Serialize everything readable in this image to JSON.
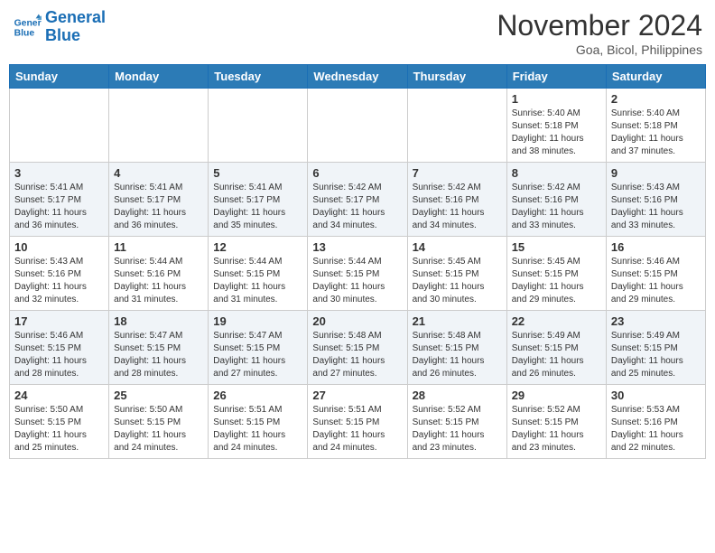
{
  "header": {
    "logo_line1": "General",
    "logo_line2": "Blue",
    "month": "November 2024",
    "location": "Goa, Bicol, Philippines"
  },
  "weekdays": [
    "Sunday",
    "Monday",
    "Tuesday",
    "Wednesday",
    "Thursday",
    "Friday",
    "Saturday"
  ],
  "weeks": [
    [
      {
        "day": "",
        "info": ""
      },
      {
        "day": "",
        "info": ""
      },
      {
        "day": "",
        "info": ""
      },
      {
        "day": "",
        "info": ""
      },
      {
        "day": "",
        "info": ""
      },
      {
        "day": "1",
        "info": "Sunrise: 5:40 AM\nSunset: 5:18 PM\nDaylight: 11 hours\nand 38 minutes."
      },
      {
        "day": "2",
        "info": "Sunrise: 5:40 AM\nSunset: 5:18 PM\nDaylight: 11 hours\nand 37 minutes."
      }
    ],
    [
      {
        "day": "3",
        "info": "Sunrise: 5:41 AM\nSunset: 5:17 PM\nDaylight: 11 hours\nand 36 minutes."
      },
      {
        "day": "4",
        "info": "Sunrise: 5:41 AM\nSunset: 5:17 PM\nDaylight: 11 hours\nand 36 minutes."
      },
      {
        "day": "5",
        "info": "Sunrise: 5:41 AM\nSunset: 5:17 PM\nDaylight: 11 hours\nand 35 minutes."
      },
      {
        "day": "6",
        "info": "Sunrise: 5:42 AM\nSunset: 5:17 PM\nDaylight: 11 hours\nand 34 minutes."
      },
      {
        "day": "7",
        "info": "Sunrise: 5:42 AM\nSunset: 5:16 PM\nDaylight: 11 hours\nand 34 minutes."
      },
      {
        "day": "8",
        "info": "Sunrise: 5:42 AM\nSunset: 5:16 PM\nDaylight: 11 hours\nand 33 minutes."
      },
      {
        "day": "9",
        "info": "Sunrise: 5:43 AM\nSunset: 5:16 PM\nDaylight: 11 hours\nand 33 minutes."
      }
    ],
    [
      {
        "day": "10",
        "info": "Sunrise: 5:43 AM\nSunset: 5:16 PM\nDaylight: 11 hours\nand 32 minutes."
      },
      {
        "day": "11",
        "info": "Sunrise: 5:44 AM\nSunset: 5:16 PM\nDaylight: 11 hours\nand 31 minutes."
      },
      {
        "day": "12",
        "info": "Sunrise: 5:44 AM\nSunset: 5:15 PM\nDaylight: 11 hours\nand 31 minutes."
      },
      {
        "day": "13",
        "info": "Sunrise: 5:44 AM\nSunset: 5:15 PM\nDaylight: 11 hours\nand 30 minutes."
      },
      {
        "day": "14",
        "info": "Sunrise: 5:45 AM\nSunset: 5:15 PM\nDaylight: 11 hours\nand 30 minutes."
      },
      {
        "day": "15",
        "info": "Sunrise: 5:45 AM\nSunset: 5:15 PM\nDaylight: 11 hours\nand 29 minutes."
      },
      {
        "day": "16",
        "info": "Sunrise: 5:46 AM\nSunset: 5:15 PM\nDaylight: 11 hours\nand 29 minutes."
      }
    ],
    [
      {
        "day": "17",
        "info": "Sunrise: 5:46 AM\nSunset: 5:15 PM\nDaylight: 11 hours\nand 28 minutes."
      },
      {
        "day": "18",
        "info": "Sunrise: 5:47 AM\nSunset: 5:15 PM\nDaylight: 11 hours\nand 28 minutes."
      },
      {
        "day": "19",
        "info": "Sunrise: 5:47 AM\nSunset: 5:15 PM\nDaylight: 11 hours\nand 27 minutes."
      },
      {
        "day": "20",
        "info": "Sunrise: 5:48 AM\nSunset: 5:15 PM\nDaylight: 11 hours\nand 27 minutes."
      },
      {
        "day": "21",
        "info": "Sunrise: 5:48 AM\nSunset: 5:15 PM\nDaylight: 11 hours\nand 26 minutes."
      },
      {
        "day": "22",
        "info": "Sunrise: 5:49 AM\nSunset: 5:15 PM\nDaylight: 11 hours\nand 26 minutes."
      },
      {
        "day": "23",
        "info": "Sunrise: 5:49 AM\nSunset: 5:15 PM\nDaylight: 11 hours\nand 25 minutes."
      }
    ],
    [
      {
        "day": "24",
        "info": "Sunrise: 5:50 AM\nSunset: 5:15 PM\nDaylight: 11 hours\nand 25 minutes."
      },
      {
        "day": "25",
        "info": "Sunrise: 5:50 AM\nSunset: 5:15 PM\nDaylight: 11 hours\nand 24 minutes."
      },
      {
        "day": "26",
        "info": "Sunrise: 5:51 AM\nSunset: 5:15 PM\nDaylight: 11 hours\nand 24 minutes."
      },
      {
        "day": "27",
        "info": "Sunrise: 5:51 AM\nSunset: 5:15 PM\nDaylight: 11 hours\nand 24 minutes."
      },
      {
        "day": "28",
        "info": "Sunrise: 5:52 AM\nSunset: 5:15 PM\nDaylight: 11 hours\nand 23 minutes."
      },
      {
        "day": "29",
        "info": "Sunrise: 5:52 AM\nSunset: 5:15 PM\nDaylight: 11 hours\nand 23 minutes."
      },
      {
        "day": "30",
        "info": "Sunrise: 5:53 AM\nSunset: 5:16 PM\nDaylight: 11 hours\nand 22 minutes."
      }
    ]
  ]
}
